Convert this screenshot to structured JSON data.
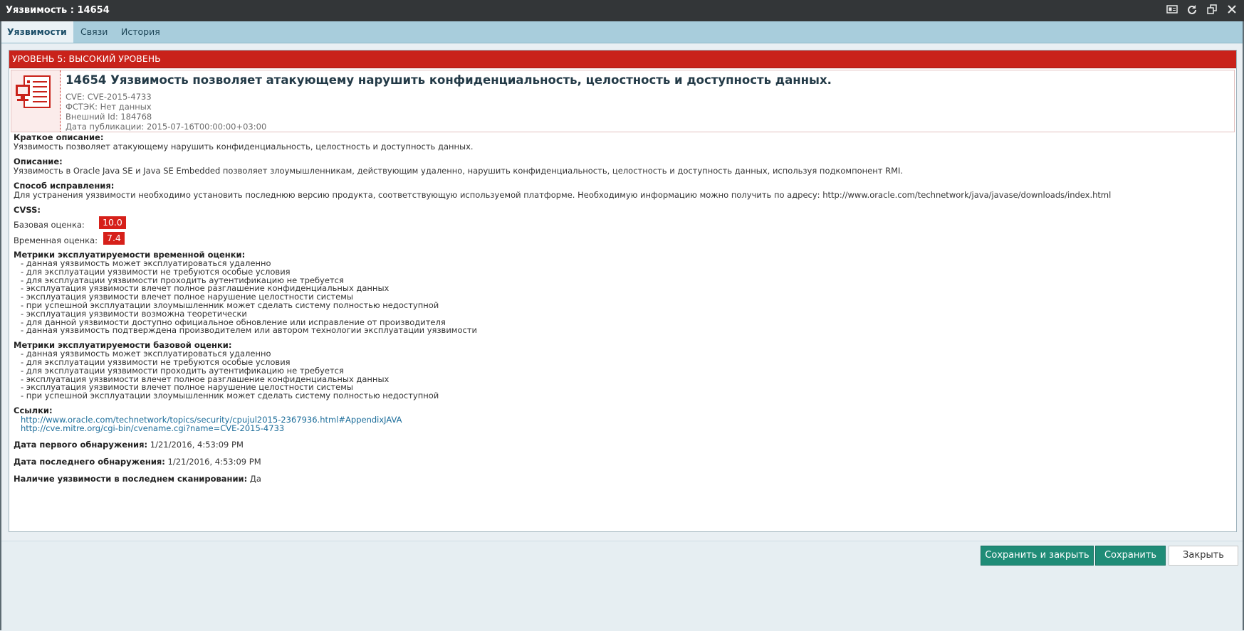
{
  "window": {
    "title": "Уязвимость : 14654",
    "icons": [
      "id-card-icon",
      "refresh-icon",
      "restore-window-icon",
      "close-icon"
    ]
  },
  "tabs": [
    {
      "label": "Уязвимости",
      "active": true
    },
    {
      "label": "Связи",
      "active": false
    },
    {
      "label": "История",
      "active": false
    }
  ],
  "severity": {
    "label": "УРОВЕНЬ 5: ВЫСОКИЙ УРОВЕНЬ",
    "color": "#c9221a"
  },
  "header": {
    "title": "14654 Уязвимость позволяет атакующему нарушить конфиденциальность, целостность и доступность данных.",
    "cve": "CVE: CVE-2015-4733",
    "fstek": "ФСТЭК: Нет данных",
    "external_id": "Внешний Id: 184768",
    "published": "Дата публикации: 2015-07-16T00:00:00+03:00"
  },
  "short_description": {
    "title": "Краткое описание:",
    "text": "Уязвимость позволяет атакующему нарушить конфиденциальность, целостность и доступность данных."
  },
  "description": {
    "title": "Описание:",
    "text": "Уязвимость в Oracle Java SE и Java SE Embedded позволяет злоумышленникам, действующим удаленно, нарушить конфиденциальность, целостность и доступность данных, используя подкомпонент RMI."
  },
  "fix": {
    "title": "Способ исправления:",
    "text": "Для устранения уязвимости необходимо установить последнюю версию продукта, соответствующую используемой платформе. Необходимую информацию можно получить по адресу: http://www.oracle.com/technetwork/java/javase/downloads/index.html"
  },
  "cvss": {
    "title": "CVSS:",
    "base_label": "Базовая оценка:",
    "base_value": "10.0",
    "temporal_label": "Временная оценка:",
    "temporal_value": "7.4",
    "badge_color": "#d6201a"
  },
  "temporal_metrics": {
    "title": "Метрики эксплуатируемости временной оценки:",
    "items": [
      "- данная уязвимость может эксплуатироваться удаленно",
      "- для эксплуатации уязвимости не требуются особые условия",
      "- для эксплуатации уязвимости проходить аутентификацию не требуется",
      "- эксплуатация уязвимости влечет полное разглашение конфиденциальных данных",
      "- эксплуатация уязвимости влечет полное нарушение целостности системы",
      "- при успешной эксплуатации злоумышленник может сделать систему полностью недоступной",
      "- эксплуатация уязвимости возможна теоретически",
      "- для данной уязвимости доступно официальное обновление или исправление от производителя",
      "- данная уязвимость подтверждена производителем или автором технологии эксплуатации уязвимости"
    ]
  },
  "base_metrics": {
    "title": "Метрики эксплуатируемости базовой оценки:",
    "items": [
      "- данная уязвимость может эксплуатироваться удаленно",
      "- для эксплуатации уязвимости не требуются особые условия",
      "- для эксплуатации уязвимости проходить аутентификацию не требуется",
      "- эксплуатация уязвимости влечет полное разглашение конфиденциальных данных",
      "- эксплуатация уязвимости влечет полное нарушение целостности системы",
      "- при успешной эксплуатации злоумышленник может сделать систему полностью недоступной"
    ]
  },
  "links": {
    "title": "Ссылки:",
    "items": [
      "http://www.oracle.com/technetwork/topics/security/cpujul2015-2367936.html#AppendixJAVA",
      "http://cve.mitre.org/cgi-bin/cvename.cgi?name=CVE-2015-4733"
    ]
  },
  "first_detected": {
    "label": "Дата первого обнаружения:",
    "value": "1/21/2016, 4:53:09 PM"
  },
  "last_detected": {
    "label": "Дата последнего обнаружения:",
    "value": "1/21/2016, 4:53:09 PM"
  },
  "in_last_scan": {
    "label": "Наличие уязвимости в последнем сканировании:",
    "value": "Да"
  },
  "buttons": {
    "save_close": "Сохранить и закрыть",
    "save": "Сохранить",
    "close": "Закрыть"
  }
}
